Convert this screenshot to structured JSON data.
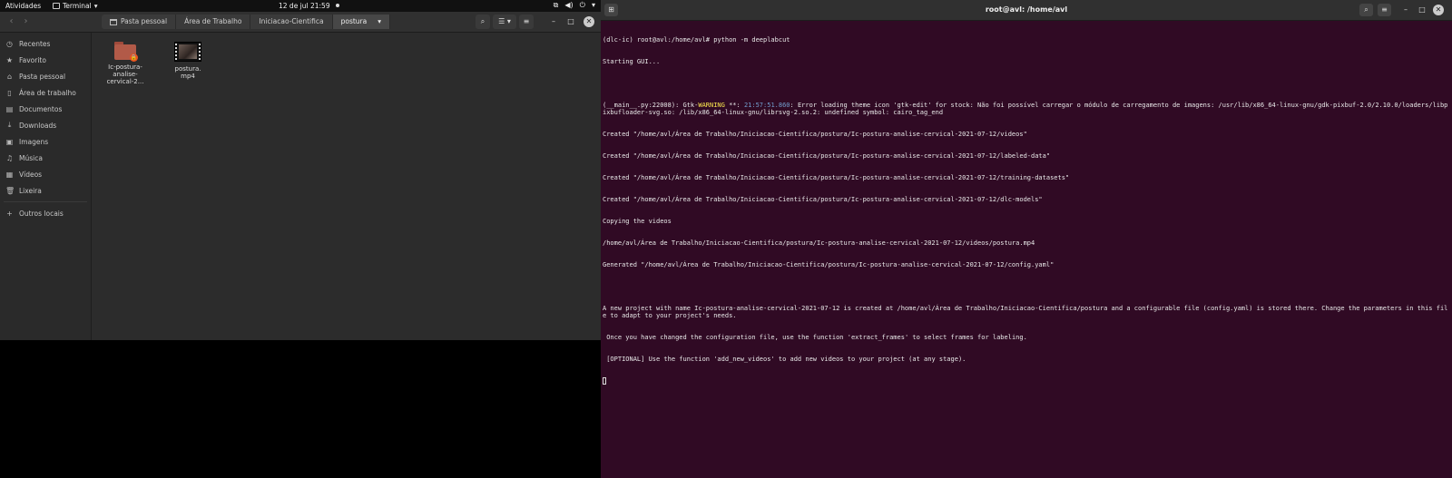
{
  "topbar": {
    "activities": "Atividades",
    "app_name": "Terminal",
    "clock": "12 de jul  21:59"
  },
  "file_manager": {
    "breadcrumb": [
      "Pasta pessoal",
      "Área de Trabalho",
      "Iniciacao-Cientifica",
      "postura"
    ],
    "sidebar": [
      {
        "icon": "clock-icon",
        "label": "Recentes"
      },
      {
        "icon": "star-icon",
        "label": "Favorito"
      },
      {
        "icon": "home-icon",
        "label": "Pasta pessoal"
      },
      {
        "icon": "desktop-icon",
        "label": "Área de trabalho"
      },
      {
        "icon": "document-icon",
        "label": "Documentos"
      },
      {
        "icon": "download-icon",
        "label": "Downloads"
      },
      {
        "icon": "image-icon",
        "label": "Imagens"
      },
      {
        "icon": "music-icon",
        "label": "Música"
      },
      {
        "icon": "video-icon",
        "label": "Vídeos"
      },
      {
        "icon": "trash-icon",
        "label": "Lixeira"
      },
      {
        "icon": "plus-icon",
        "label": "Outros locais"
      }
    ],
    "files": [
      {
        "name_line1": "Ic-postura-",
        "name_line2": "analise-",
        "name_line3": "cervical-2...",
        "type": "folder"
      },
      {
        "name_line1": "postura.",
        "name_line2": "mp4",
        "type": "video"
      }
    ]
  },
  "terminal": {
    "title": "root@avl: /home/avl",
    "lines": [
      "(dlc-ic) root@avl:/home/avl# python -m deeplabcut",
      "Starting GUI...",
      "",
      {
        "pre": "(__main__.py:22008): Gtk-",
        "warn": "WARNING",
        "mid": " **: ",
        "ts": "21:57:51.860",
        "post": ": Error loading theme icon 'gtk-edit' for stock: Não foi possível carregar o módulo de carregamento de imagens: /usr/lib/x86_64-linux-gnu/gdk-pixbuf-2.0/2.10.0/loaders/libpixbufloader-svg.so: /lib/x86_64-linux-gnu/librsvg-2.so.2: undefined symbol: cairo_tag_end"
      },
      "Created \"/home/avl/Área de Trabalho/Iniciacao-Cientifica/postura/Ic-postura-analise-cervical-2021-07-12/videos\"",
      "Created \"/home/avl/Área de Trabalho/Iniciacao-Cientifica/postura/Ic-postura-analise-cervical-2021-07-12/labeled-data\"",
      "Created \"/home/avl/Área de Trabalho/Iniciacao-Cientifica/postura/Ic-postura-analise-cervical-2021-07-12/training-datasets\"",
      "Created \"/home/avl/Área de Trabalho/Iniciacao-Cientifica/postura/Ic-postura-analise-cervical-2021-07-12/dlc-models\"",
      "Copying the videos",
      "/home/avl/Área de Trabalho/Iniciacao-Cientifica/postura/Ic-postura-analise-cervical-2021-07-12/videos/postura.mp4",
      "Generated \"/home/avl/Área de Trabalho/Iniciacao-Cientifica/postura/Ic-postura-analise-cervical-2021-07-12/config.yaml\"",
      "",
      "A new project with name Ic-postura-analise-cervical-2021-07-12 is created at /home/avl/Área de Trabalho/Iniciacao-Cientifica/postura and a configurable file (config.yaml) is stored there. Change the parameters in this file to adapt to your project's needs.",
      " Once you have changed the configuration file, use the function 'extract_frames' to select frames for labeling.",
      " [OPTIONAL] Use the function 'add_new_videos' to add new videos to your project (at any stage)."
    ]
  }
}
